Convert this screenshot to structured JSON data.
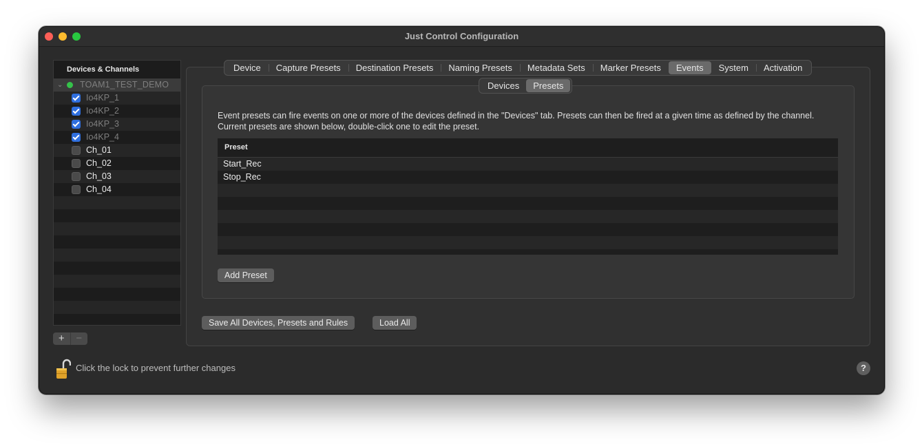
{
  "window": {
    "title": "Just Control Configuration"
  },
  "sidebar": {
    "header": "Devices & Channels",
    "group": {
      "label": "TOAM1_TEST_DEMO",
      "expanded": true,
      "status_color": "#35c24a"
    },
    "channels": [
      {
        "label": "Io4KP_1",
        "checked": true
      },
      {
        "label": "Io4KP_2",
        "checked": true
      },
      {
        "label": "Io4KP_3",
        "checked": true
      },
      {
        "label": "Io4KP_4",
        "checked": true
      },
      {
        "label": "Ch_01",
        "checked": false
      },
      {
        "label": "Ch_02",
        "checked": false
      },
      {
        "label": "Ch_03",
        "checked": false
      },
      {
        "label": "Ch_04",
        "checked": false
      }
    ],
    "add_label": "+",
    "remove_label": "−"
  },
  "tabs": {
    "items": [
      "Device",
      "Capture Presets",
      "Destination Presets",
      "Naming Presets",
      "Metadata Sets",
      "Marker Presets",
      "Events",
      "System",
      "Activation"
    ],
    "active": "Events"
  },
  "subtabs": {
    "items": [
      "Devices",
      "Presets"
    ],
    "active": "Presets"
  },
  "events": {
    "description": "Event presets can fire events on one or more of the devices defined in the \"Devices\" tab. Presets can then be fired at a given time as defined by the channel. Current presets are shown below, double-click one to edit the preset.",
    "table_header": "Preset",
    "presets": [
      "Start_Rec",
      "Stop_Rec"
    ],
    "add_button": "Add Preset"
  },
  "footer": {
    "save_button": "Save All Devices, Presets and Rules",
    "load_button": "Load All",
    "lock_text": "Click the lock to prevent further changes",
    "help_label": "?"
  },
  "colors": {
    "accent_checkbox": "#2f6fdf",
    "lock_icon": "#e0a22a"
  }
}
